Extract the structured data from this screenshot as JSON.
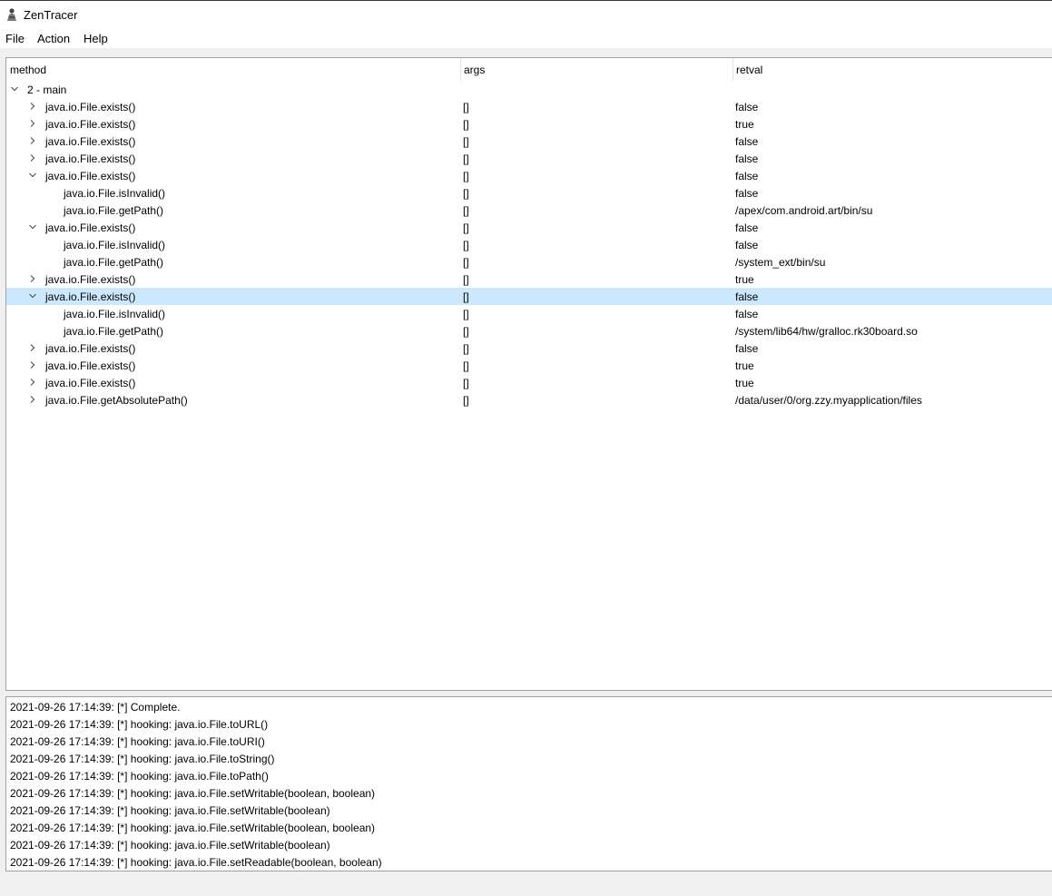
{
  "window": {
    "title": "ZenTracer"
  },
  "menu": [
    "File",
    "Action",
    "Help"
  ],
  "tree": {
    "columns": [
      "method",
      "args",
      "retval"
    ],
    "rows": [
      {
        "method": "2 - main",
        "args": "",
        "retval": "",
        "level": 0,
        "expander": "expanded",
        "selected": false
      },
      {
        "method": "java.io.File.exists()",
        "args": "[]",
        "retval": "false",
        "level": 1,
        "expander": "collapsed",
        "selected": false
      },
      {
        "method": "java.io.File.exists()",
        "args": "[]",
        "retval": "true",
        "level": 1,
        "expander": "collapsed",
        "selected": false
      },
      {
        "method": "java.io.File.exists()",
        "args": "[]",
        "retval": "false",
        "level": 1,
        "expander": "collapsed",
        "selected": false
      },
      {
        "method": "java.io.File.exists()",
        "args": "[]",
        "retval": "false",
        "level": 1,
        "expander": "collapsed",
        "selected": false
      },
      {
        "method": "java.io.File.exists()",
        "args": "[]",
        "retval": "false",
        "level": 1,
        "expander": "expanded",
        "selected": false
      },
      {
        "method": "java.io.File.isInvalid()",
        "args": "[]",
        "retval": "false",
        "level": 2,
        "expander": "none",
        "selected": false
      },
      {
        "method": "java.io.File.getPath()",
        "args": "[]",
        "retval": "/apex/com.android.art/bin/su",
        "level": 2,
        "expander": "none",
        "selected": false
      },
      {
        "method": "java.io.File.exists()",
        "args": "[]",
        "retval": "false",
        "level": 1,
        "expander": "expanded",
        "selected": false
      },
      {
        "method": "java.io.File.isInvalid()",
        "args": "[]",
        "retval": "false",
        "level": 2,
        "expander": "none",
        "selected": false
      },
      {
        "method": "java.io.File.getPath()",
        "args": "[]",
        "retval": "/system_ext/bin/su",
        "level": 2,
        "expander": "none",
        "selected": false
      },
      {
        "method": "java.io.File.exists()",
        "args": "[]",
        "retval": "true",
        "level": 1,
        "expander": "collapsed",
        "selected": false
      },
      {
        "method": "java.io.File.exists()",
        "args": "[]",
        "retval": "false",
        "level": 1,
        "expander": "expanded",
        "selected": true
      },
      {
        "method": "java.io.File.isInvalid()",
        "args": "[]",
        "retval": "false",
        "level": 2,
        "expander": "none",
        "selected": false
      },
      {
        "method": "java.io.File.getPath()",
        "args": "[]",
        "retval": "/system/lib64/hw/gralloc.rk30board.so",
        "level": 2,
        "expander": "none",
        "selected": false
      },
      {
        "method": "java.io.File.exists()",
        "args": "[]",
        "retval": "false",
        "level": 1,
        "expander": "collapsed",
        "selected": false
      },
      {
        "method": "java.io.File.exists()",
        "args": "[]",
        "retval": "true",
        "level": 1,
        "expander": "collapsed",
        "selected": false
      },
      {
        "method": "java.io.File.exists()",
        "args": "[]",
        "retval": "true",
        "level": 1,
        "expander": "collapsed",
        "selected": false
      },
      {
        "method": "java.io.File.getAbsolutePath()",
        "args": "[]",
        "retval": "/data/user/0/org.zzy.myapplication/files",
        "level": 1,
        "expander": "collapsed",
        "selected": false
      }
    ]
  },
  "log": [
    "2021-09-26 17:14:39:  [*] Complete.",
    "2021-09-26 17:14:39:  [*] hooking: java.io.File.toURL()",
    "2021-09-26 17:14:39:  [*] hooking: java.io.File.toURI()",
    "2021-09-26 17:14:39:  [*] hooking: java.io.File.toString()",
    "2021-09-26 17:14:39:  [*] hooking: java.io.File.toPath()",
    "2021-09-26 17:14:39:  [*] hooking: java.io.File.setWritable(boolean, boolean)",
    "2021-09-26 17:14:39:  [*] hooking: java.io.File.setWritable(boolean)",
    "2021-09-26 17:14:39:  [*] hooking: java.io.File.setWritable(boolean, boolean)",
    "2021-09-26 17:14:39:  [*] hooking: java.io.File.setWritable(boolean)",
    "2021-09-26 17:14:39:  [*] hooking: java.io.File.setReadable(boolean, boolean)"
  ],
  "colors": {
    "selection": "#cce8ff",
    "pane_border": "#a0a0a0",
    "window_bg": "#f0f0f0"
  },
  "icons": {
    "app": "zentracer-app-icon",
    "expanded": "chevron-down-icon",
    "collapsed": "chevron-right-icon"
  }
}
